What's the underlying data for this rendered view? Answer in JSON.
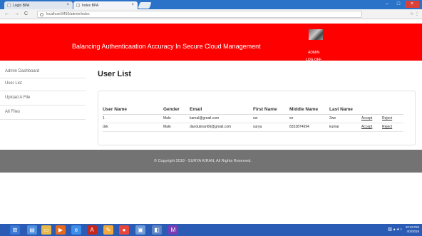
{
  "browser": {
    "tabs": [
      {
        "label": "Login BPA",
        "close": "×"
      },
      {
        "label": "Index BPA",
        "close": "×"
      }
    ],
    "window_controls": {
      "minimize": "–",
      "maximize": "□",
      "close": "×"
    },
    "nav": {
      "back": "←",
      "forward": "→",
      "reload": "C"
    },
    "url": "localhost:8450/admin/index",
    "extensions": "☆ ⋮"
  },
  "header": {
    "title": "Balancing Authenticaation Accuracy In Secure Cloud Management",
    "user_label": "ADMIN",
    "logoff_label": "LOG OFF"
  },
  "sidebar": {
    "items": [
      {
        "label": "Admin Dashboard"
      },
      {
        "label": "User List"
      },
      {
        "label": "Upload A File"
      },
      {
        "label": "All Files"
      }
    ]
  },
  "main": {
    "title": "User List",
    "columns": [
      "User Name",
      "Gender",
      "Email",
      "First Name",
      "Middle Name",
      "Last Name",
      "",
      ""
    ],
    "rows": [
      {
        "user_name": "1",
        "gender": "Male",
        "email": "kamal@gmail.com",
        "first_name": "ew",
        "middle_name": "wr",
        "last_name": "2we",
        "accept": "Accept",
        "reject": "Reject"
      },
      {
        "user_name": "dsk",
        "gender": "Male",
        "email": "dandukiran66@gmail.com",
        "first_name": "surya",
        "middle_name": "8333874694",
        "last_name": "kumar",
        "accept": "Accept",
        "reject": "Reject"
      }
    ]
  },
  "footer": {
    "text": "© Copyright 2018 - SURYA KIRAN, All Rights Reserved."
  },
  "taskbar": {
    "icons": [
      "start-icon",
      "explorer-icon",
      "folder-icon",
      "media-icon",
      "ie-icon",
      "adobe-icon",
      "paint-icon",
      "chrome-icon",
      "settings-icon",
      "network-icon",
      "visual-studio-icon"
    ],
    "time": "10:23 PM",
    "date": "4/3/2018"
  },
  "colors": {
    "header_bg": "#ff0000",
    "footer_bg": "#737373",
    "taskbar_bg": "#2a5bb5",
    "tabbar_bg": "#2b73c9"
  }
}
